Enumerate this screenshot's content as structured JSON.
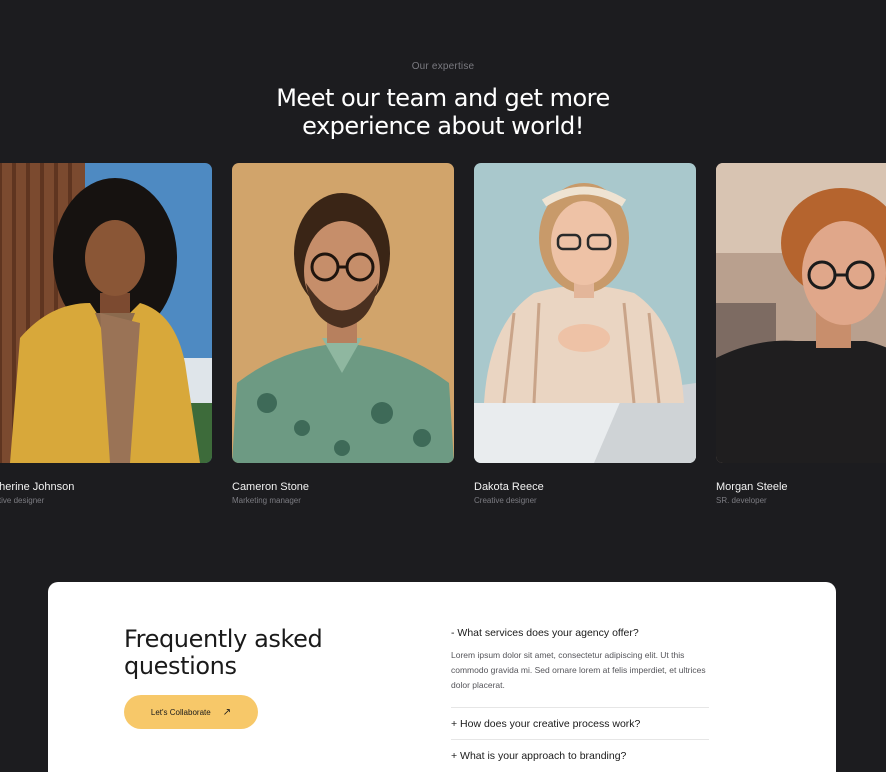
{
  "section": {
    "eyebrow": "Our expertise",
    "headline_line1": "Meet our team and get more",
    "headline_line2": "experience about world!"
  },
  "team": [
    {
      "name": "Catherine Johnson",
      "visible_name": "atherine Johnson",
      "role": "Creative designer",
      "visible_role": "eative designer"
    },
    {
      "name": "Cameron Stone",
      "visible_name": "Cameron Stone",
      "role": "Marketing manager",
      "visible_role": "Marketing manager"
    },
    {
      "name": "Dakota Reece",
      "visible_name": "Dakota Reece",
      "role": "Creative designer",
      "visible_role": "Creative designer"
    },
    {
      "name": "Morgan Steele",
      "visible_name": "Morgan Steele",
      "role": "SR. developer",
      "visible_role": "SR. developer"
    }
  ],
  "faq": {
    "title_line1": "Frequently asked",
    "title_line2": "questions",
    "cta_label": "Let's Collaborate",
    "cta_icon": "arrow-up-right-icon",
    "items": [
      {
        "question": "- What services does your agency offer?",
        "answer": "Lorem ipsum dolor sit amet, consectetur adipiscing elit. Ut this commodo gravida mi. Sed ornare lorem at felis imperdiet, et ultrices dolor placerat.",
        "expanded": true
      },
      {
        "question": "+ How does your creative process work?",
        "expanded": false
      },
      {
        "question": "+ What is your approach to branding?",
        "expanded": false
      }
    ]
  },
  "colors": {
    "background": "#1c1c1f",
    "accent": "#f7c869",
    "panel": "#ffffff"
  }
}
